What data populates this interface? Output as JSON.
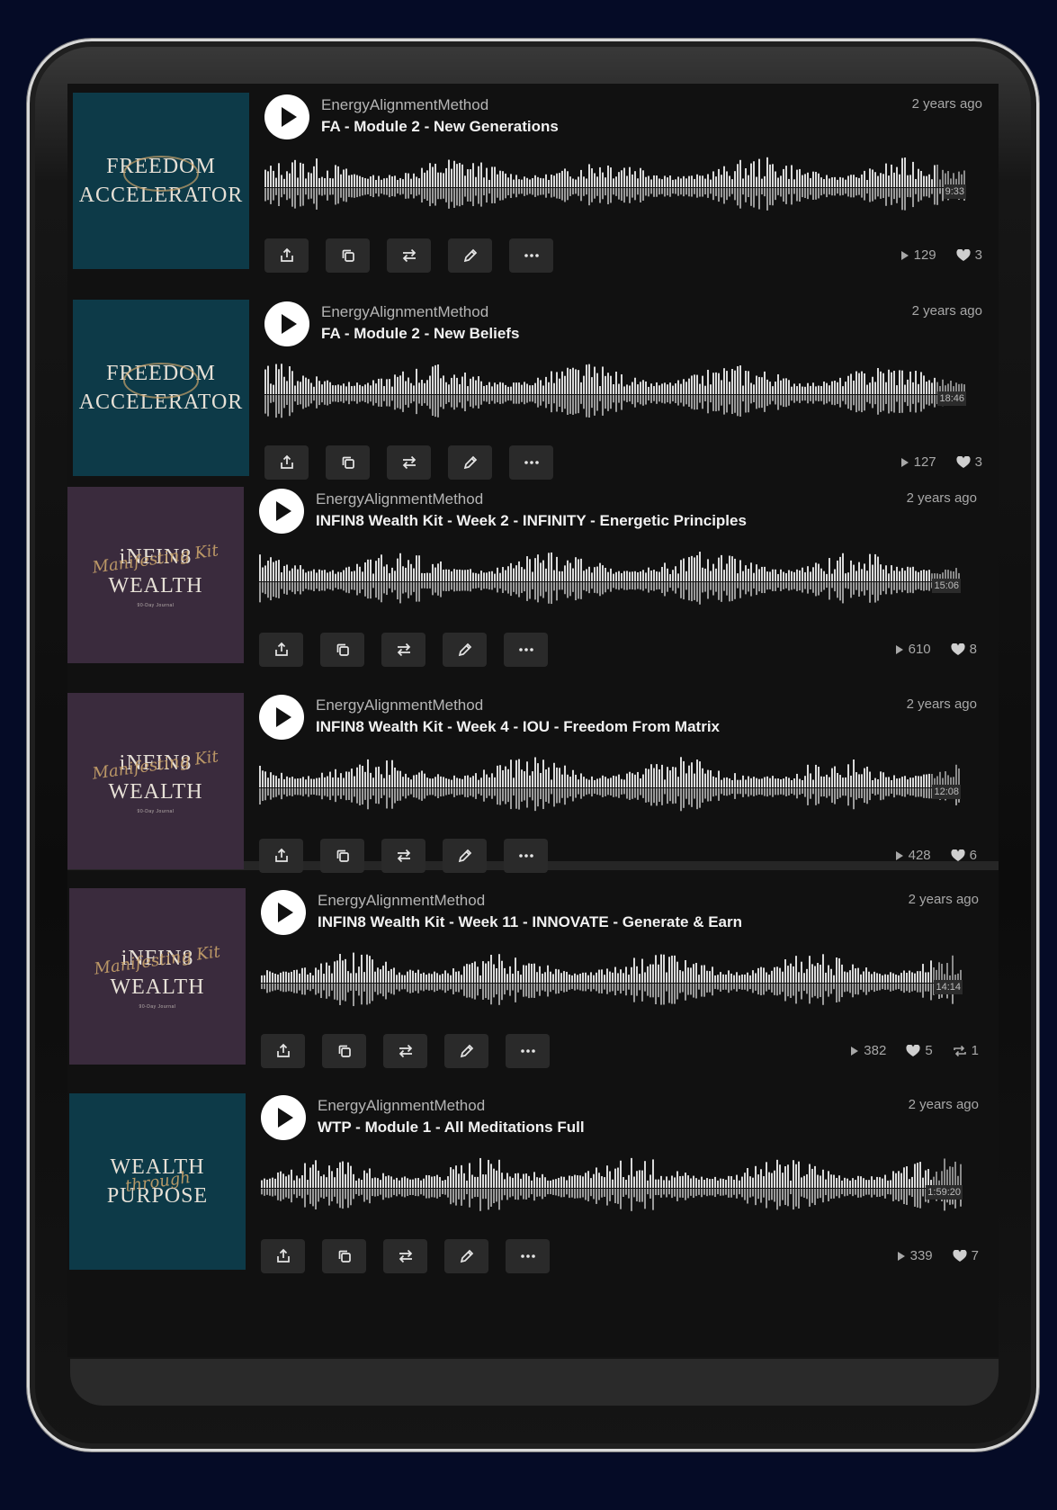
{
  "colors": {
    "background": "#050b26",
    "panel": "#111111",
    "accent": "#ffffff"
  },
  "tracks": [
    {
      "artist": "EnergyAlignmentMethod",
      "title": "FA - Module 2 - New Generations",
      "age": "2 years ago",
      "duration": "9:33",
      "plays": "129",
      "likes": "3",
      "reposts": "",
      "art": {
        "line1": "FREEDOM",
        "line2": "ACCELERATOR",
        "small": "",
        "script": ""
      }
    },
    {
      "artist": "EnergyAlignmentMethod",
      "title": "FA - Module 2 - New Beliefs",
      "age": "2 years ago",
      "duration": "18:46",
      "plays": "127",
      "likes": "3",
      "reposts": "",
      "art": {
        "line1": "FREEDOM",
        "line2": "ACCELERATOR",
        "small": "",
        "script": ""
      }
    },
    {
      "artist": "EnergyAlignmentMethod",
      "title": "INFIN8 Wealth Kit - Week 2 - INFINITY - Energetic Principles",
      "age": "2 years ago",
      "duration": "15:06",
      "plays": "610",
      "likes": "8",
      "reposts": "",
      "art": {
        "line1": "iNFIN8",
        "line2": "WEALTH",
        "small": "90-Day Journal",
        "script": "Manifesting Kit"
      }
    },
    {
      "artist": "EnergyAlignmentMethod",
      "title": "INFIN8 Wealth Kit - Week 4 - IOU - Freedom From Matrix",
      "age": "2 years ago",
      "duration": "12:08",
      "plays": "428",
      "likes": "6",
      "reposts": "",
      "art": {
        "line1": "iNFIN8",
        "line2": "WEALTH",
        "small": "90-Day Journal",
        "script": "Manifesting Kit"
      }
    },
    {
      "artist": "EnergyAlignmentMethod",
      "title": "INFIN8 Wealth Kit - Week 11 - INNOVATE - Generate & Earn",
      "age": "2 years ago",
      "duration": "14:14",
      "plays": "382",
      "likes": "5",
      "reposts": "1",
      "art": {
        "line1": "iNFIN8",
        "line2": "WEALTH",
        "small": "90-Day Journal",
        "script": "Manifesting Kit"
      }
    },
    {
      "artist": "EnergyAlignmentMethod",
      "title": "WTP - Module 1 - All Meditations Full",
      "age": "2 years ago",
      "duration": "1:59:20",
      "plays": "339",
      "likes": "7",
      "reposts": "",
      "art": {
        "line1": "WEALTH",
        "line2": "PURPOSE",
        "small": "",
        "script": "through"
      }
    }
  ],
  "icons": {
    "play": "play-icon",
    "share": "share-icon",
    "copy": "copy-icon",
    "repost": "repost-icon",
    "edit": "edit-icon",
    "more": "more-icon",
    "plays": "play-count-icon",
    "likes": "heart-icon",
    "reposts": "repost-count-icon"
  }
}
